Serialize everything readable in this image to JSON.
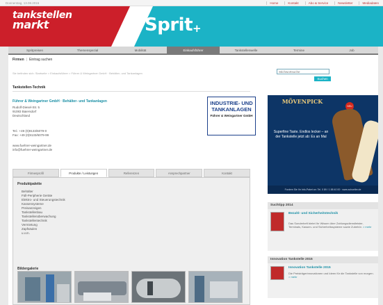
{
  "topbar": {
    "date": "Donnerstag, 13.08.2015",
    "links": [
      "Home",
      "Kontakt",
      "Abo & Service",
      "Newsletter",
      "Mediadaten"
    ]
  },
  "header": {
    "logo_line1": "tankstellen",
    "logo_line2": "markt",
    "product": "Sprit",
    "plus": "+"
  },
  "nav": {
    "items": [
      "Spritpreisen",
      "Themenspezial",
      "Mobilität",
      "Einkaufsführer",
      "Tankstellenwelle",
      "Termine",
      "Job"
    ],
    "active_index": 3
  },
  "subnav": {
    "tab_firmen": "Firmen",
    "sep": "|",
    "tab_eintrag": "Eintrag suchen"
  },
  "breadcrumb": "Sie befinden sich: Startseite > Einkaufsführer > Führer & Weingartner GmbH · Behälter- und Tankanlagen",
  "search": {
    "placeholder": "Stichwortsuche",
    "button": "Suchen"
  },
  "listing": {
    "title": "Tankstellen-Technik",
    "company_name": "Führer & Weingartner GmbH · Behälter- und Tankanlagen",
    "address": [
      "Rudolf-Diesel-Str. 5",
      "91083 Baiersdorf",
      "Deutschland"
    ],
    "phone": [
      "Tel.: +49 (0)9133/6079-0",
      "Fax: +49 (0)9133/6079-99"
    ],
    "web": [
      "www.fuehrer-weingartner.de",
      "info@fuehrer-weingartner.de"
    ],
    "logo_main": "INDUSTRIE- UND TANKANLAGEN",
    "logo_sub": "Führer & Weingartner GmbH"
  },
  "tabs": [
    "Firmenprofil",
    "Produkte / Leistungen",
    "Referenzen",
    "Ansprechpartner",
    "Kontakt"
  ],
  "products": {
    "heading": "Produktpalette",
    "items": [
      "Behälter",
      "Füll-Peripherie Geräte",
      "Elektro- und Steuerungstechnik",
      "Kassensysteme",
      "Preisanzeigen",
      "Tankstellenbau",
      "Tankstellenüberwachung",
      "Tankstellentechnik",
      "Vermietung",
      "Zapfsäulen",
      "u.v.m."
    ]
  },
  "gallery": {
    "heading": "Bildergalerie"
  },
  "ad": {
    "brand": "MÖVENPICK",
    "tagline": "Superfine Taste. Endlos lecker – an der Tankstelle jetzt ab: Es an Mal",
    "badge": "NEU",
    "footer": "Fordern Sie Ihr Info-Paket an: Tel. 0 89 / 1 88 40 00 · www.schoeller.de"
  },
  "box1": {
    "head": "Suchtipp 2014",
    "title": "Bezahl- und Sicherheitstechnik",
    "text": "Das Sonderheft bietet Ihr Wissen über Zahlungsdienstleister, Terminals, Kassen- und Sicherheitssysteme sowie Zubehör.",
    "more": "> mehr"
  },
  "box2": {
    "head": "Innovation Tankstelle 2015",
    "title": "Innovation Tankstelle 2015",
    "text": "Die Preisträgerinnovationen und Ideen für die Tankstelle von morgen.",
    "more": "> mehr"
  },
  "colors": {
    "brand_red": "#cc1f2a",
    "teal": "#1bb3c6",
    "link": "#1a8fa5"
  }
}
